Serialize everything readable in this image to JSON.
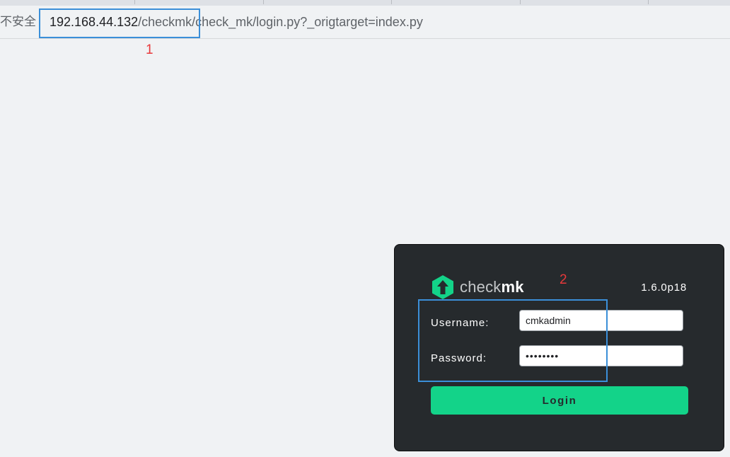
{
  "browser": {
    "security_indicator": "不安全",
    "url_host": "192.168.44.132",
    "url_path": "/checkmk/check_mk/login.py?_origtarget=index.py"
  },
  "annotations": {
    "label_1": "1",
    "label_2": "2",
    "box_color": "#3b8fd8",
    "label_color": "#e8393b"
  },
  "login": {
    "logo_light": "check",
    "logo_bold": "mk",
    "version": "1.6.0p18",
    "username_label": "Username:",
    "username_value": "cmkadmin",
    "password_label": "Password:",
    "password_value": "••••••••",
    "login_button": "Login",
    "accent_color": "#13d389",
    "panel_color": "#262a2d"
  }
}
